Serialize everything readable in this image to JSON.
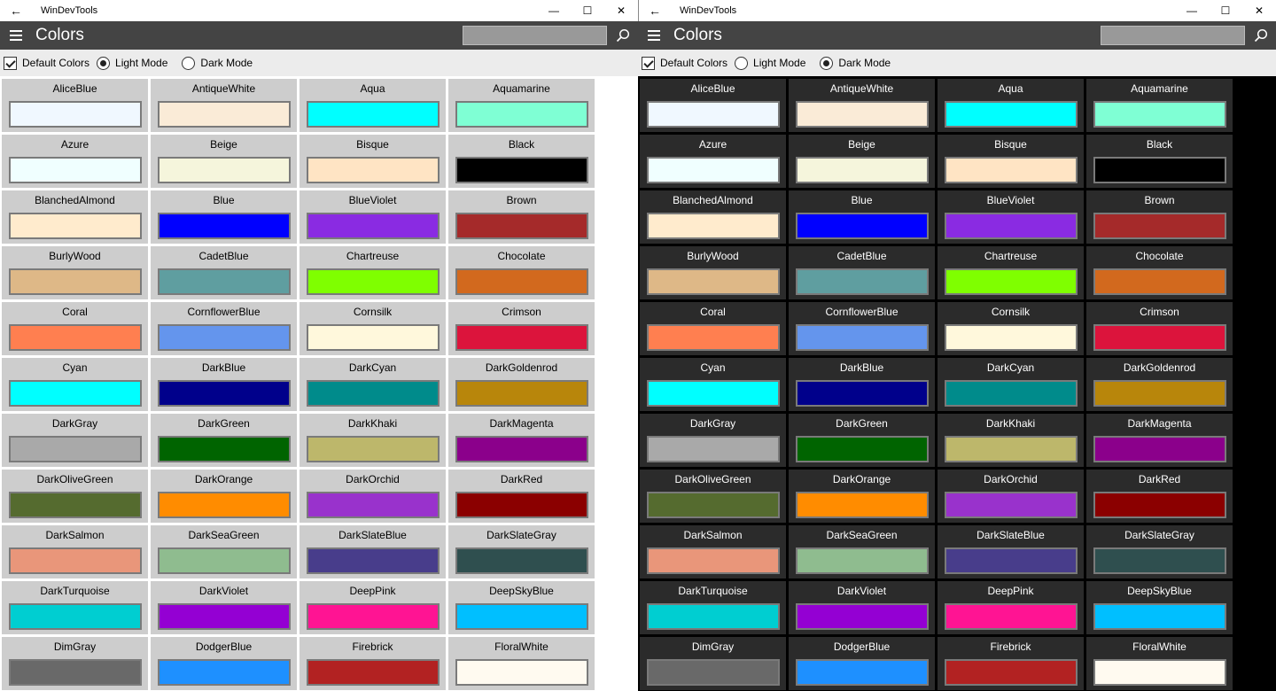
{
  "windows": [
    {
      "title": "WinDevTools",
      "page_title": "Colors",
      "default_colors_label": "Default Colors",
      "light_mode_label": "Light Mode",
      "dark_mode_label": "Dark Mode",
      "mode": "light"
    },
    {
      "title": "WinDevTools",
      "page_title": "Colors",
      "default_colors_label": "Default Colors",
      "light_mode_label": "Light Mode",
      "dark_mode_label": "Dark Mode",
      "mode": "dark"
    }
  ],
  "icons": {
    "back": "back-arrow-icon",
    "minimize": "minimize-icon",
    "maximize": "maximize-icon",
    "close": "close-icon",
    "menu": "hamburger-icon",
    "search": "search-icon"
  },
  "colors": [
    {
      "name": "AliceBlue",
      "hex": "#F0F8FF"
    },
    {
      "name": "AntiqueWhite",
      "hex": "#FAEBD7"
    },
    {
      "name": "Aqua",
      "hex": "#00FFFF"
    },
    {
      "name": "Aquamarine",
      "hex": "#7FFFD4"
    },
    {
      "name": "Azure",
      "hex": "#F0FFFF"
    },
    {
      "name": "Beige",
      "hex": "#F5F5DC"
    },
    {
      "name": "Bisque",
      "hex": "#FFE4C4"
    },
    {
      "name": "Black",
      "hex": "#000000"
    },
    {
      "name": "BlanchedAlmond",
      "hex": "#FFEBCD"
    },
    {
      "name": "Blue",
      "hex": "#0000FF"
    },
    {
      "name": "BlueViolet",
      "hex": "#8A2BE2"
    },
    {
      "name": "Brown",
      "hex": "#A52A2A"
    },
    {
      "name": "BurlyWood",
      "hex": "#DEB887"
    },
    {
      "name": "CadetBlue",
      "hex": "#5F9EA0"
    },
    {
      "name": "Chartreuse",
      "hex": "#7FFF00"
    },
    {
      "name": "Chocolate",
      "hex": "#D2691E"
    },
    {
      "name": "Coral",
      "hex": "#FF7F50"
    },
    {
      "name": "CornflowerBlue",
      "hex": "#6495ED"
    },
    {
      "name": "Cornsilk",
      "hex": "#FFF8DC"
    },
    {
      "name": "Crimson",
      "hex": "#DC143C"
    },
    {
      "name": "Cyan",
      "hex": "#00FFFF"
    },
    {
      "name": "DarkBlue",
      "hex": "#00008B"
    },
    {
      "name": "DarkCyan",
      "hex": "#008B8B"
    },
    {
      "name": "DarkGoldenrod",
      "hex": "#B8860B"
    },
    {
      "name": "DarkGray",
      "hex": "#A9A9A9"
    },
    {
      "name": "DarkGreen",
      "hex": "#006400"
    },
    {
      "name": "DarkKhaki",
      "hex": "#BDB76B"
    },
    {
      "name": "DarkMagenta",
      "hex": "#8B008B"
    },
    {
      "name": "DarkOliveGreen",
      "hex": "#556B2F"
    },
    {
      "name": "DarkOrange",
      "hex": "#FF8C00"
    },
    {
      "name": "DarkOrchid",
      "hex": "#9932CC"
    },
    {
      "name": "DarkRed",
      "hex": "#8B0000"
    },
    {
      "name": "DarkSalmon",
      "hex": "#E9967A"
    },
    {
      "name": "DarkSeaGreen",
      "hex": "#8FBC8F"
    },
    {
      "name": "DarkSlateBlue",
      "hex": "#483D8B"
    },
    {
      "name": "DarkSlateGray",
      "hex": "#2F4F4F"
    },
    {
      "name": "DarkTurquoise",
      "hex": "#00CED1"
    },
    {
      "name": "DarkViolet",
      "hex": "#9400D3"
    },
    {
      "name": "DeepPink",
      "hex": "#FF1493"
    },
    {
      "name": "DeepSkyBlue",
      "hex": "#00BFFF"
    },
    {
      "name": "DimGray",
      "hex": "#696969"
    },
    {
      "name": "DodgerBlue",
      "hex": "#1E90FF"
    },
    {
      "name": "Firebrick",
      "hex": "#B22222"
    },
    {
      "name": "FloralWhite",
      "hex": "#FFFAF0"
    }
  ]
}
